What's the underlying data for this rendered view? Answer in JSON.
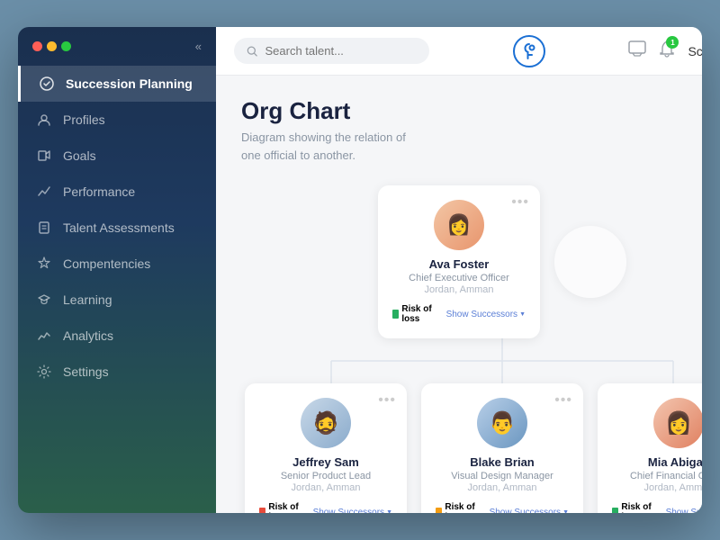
{
  "window": {
    "title": "Succession Planning - Org Chart"
  },
  "header": {
    "search_placeholder": "Search talent...",
    "user_name": "Scarlet",
    "notification_count": "1"
  },
  "sidebar": {
    "collapse_label": "«",
    "items": [
      {
        "id": "succession-planning",
        "label": "Succession Planning",
        "icon": "✓",
        "active": true
      },
      {
        "id": "profiles",
        "label": "Profiles",
        "icon": "👤"
      },
      {
        "id": "goals",
        "label": "Goals",
        "icon": "🚩"
      },
      {
        "id": "performance",
        "label": "Performance",
        "icon": "📊"
      },
      {
        "id": "talent-assessments",
        "label": "Talent Assessments",
        "icon": "📄"
      },
      {
        "id": "competencies",
        "label": "Compentencies",
        "icon": "🔔"
      },
      {
        "id": "learning",
        "label": "Learning",
        "icon": "🎓"
      },
      {
        "id": "analytics",
        "label": "Analytics",
        "icon": "📈"
      },
      {
        "id": "settings",
        "label": "Settings",
        "icon": "⚙"
      }
    ]
  },
  "main": {
    "title": "Org Chart",
    "description": "Diagram showing the relation of one official to another.",
    "add_button": "+",
    "risk_label": "Risk of loss",
    "show_successors_label": "Show Successors",
    "nodes": [
      {
        "name": "Ava Foster",
        "role": "Chief Executive Officer",
        "location": "Jordan, Amman",
        "risk_color": "green",
        "level": "top"
      },
      {
        "name": "Jeffrey Sam",
        "role": "Senior Product Lead",
        "location": "Jordan, Amman",
        "risk_color": "red",
        "level": "bottom"
      },
      {
        "name": "Blake Brian",
        "role": "Visual Design Manager",
        "location": "Jordan, Amman",
        "risk_color": "yellow",
        "level": "bottom"
      },
      {
        "name": "Mia Abigail",
        "role": "Chief Financial Officer",
        "location": "Jordan, Amman",
        "risk_color": "green",
        "level": "bottom"
      }
    ]
  }
}
